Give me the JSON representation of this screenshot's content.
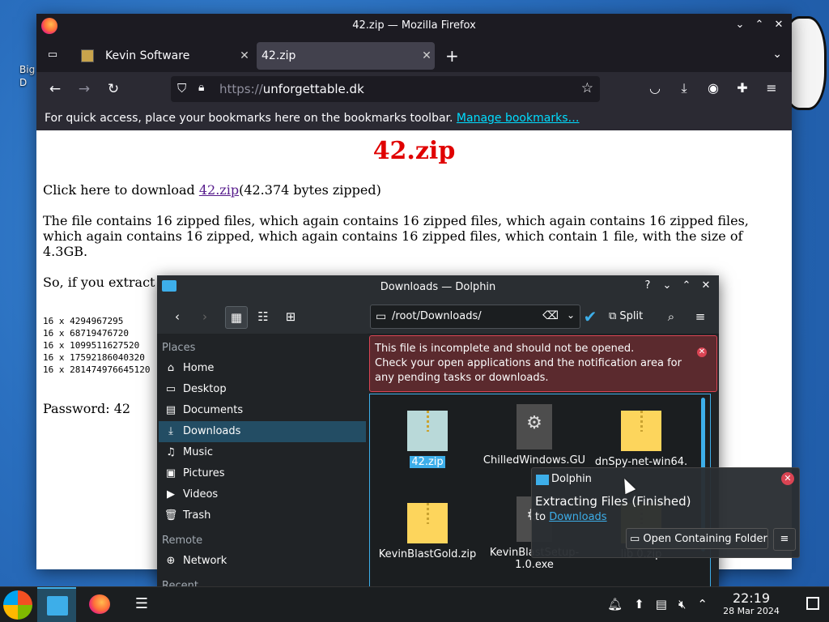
{
  "desktop": {
    "icon_label": "Big D"
  },
  "firefox": {
    "window_title": "42.zip — Mozilla Firefox",
    "tabs": [
      {
        "label": "Kevin Software"
      },
      {
        "label": "42.zip"
      }
    ],
    "url_host": "https://",
    "url_domain": "unforgettable.dk",
    "bookmarks_text": "For quick access, place your bookmarks here on the bookmarks toolbar.",
    "bookmarks_link": "Manage bookmarks…"
  },
  "page": {
    "heading": "42.zip",
    "download_prefix": "Click here to download ",
    "download_link": "42.zip",
    "download_suffix": "(42.374 bytes zipped)",
    "description": "The file contains 16 zipped files, which again contains 16 zipped files, which again contains 16 zipped files, which again contains 16 zipped, which again contains 16 zipped files, which contain 1 file, with the size of 4.3GB.",
    "so_text": "So, if you extract",
    "calc_lines": [
      "16 x 4294967295",
      "16 x 68719476720",
      "16 x 1099511627520",
      "16 x 17592186040320",
      "16 x 281474976645120"
    ],
    "password": "Password: 42"
  },
  "dolphin": {
    "title": "Downloads — Dolphin",
    "path": "/root/Downloads/",
    "split_label": "Split",
    "places_header": "Places",
    "places": [
      {
        "label": "Home",
        "icon": "home-icon"
      },
      {
        "label": "Desktop",
        "icon": "desktop-icon"
      },
      {
        "label": "Documents",
        "icon": "documents-icon"
      },
      {
        "label": "Downloads",
        "icon": "downloads-icon"
      },
      {
        "label": "Music",
        "icon": "music-icon"
      },
      {
        "label": "Pictures",
        "icon": "pictures-icon"
      },
      {
        "label": "Videos",
        "icon": "videos-icon"
      },
      {
        "label": "Trash",
        "icon": "trash-icon"
      }
    ],
    "remote_header": "Remote",
    "remote_items": [
      {
        "label": "Network"
      }
    ],
    "recent_header": "Recent",
    "warning_line1": "This file is incomplete and should not be opened.",
    "warning_line2": "Check your open applications and the notification area for any pending tasks or downloads.",
    "files": [
      {
        "name": "42.zip",
        "type": "zip"
      },
      {
        "name": "ChilledWindows.GU",
        "type": "exe"
      },
      {
        "name": "dnSpy-net-win64.",
        "type": "zip"
      },
      {
        "name": "KevinBlastGold.zip",
        "type": "zip"
      },
      {
        "name": "KevinBlastSetup-1.0.exe",
        "type": "exe"
      },
      {
        "name": "lib 0.zip",
        "type": "zip"
      }
    ]
  },
  "notification": {
    "app": "Dolphin",
    "heading": "Extracting Files (Finished)",
    "to_prefix": "to ",
    "to_link": "Downloads",
    "open_folder": "Open Containing Folder"
  },
  "taskbar": {
    "time": "22:19",
    "date": "28 Mar 2024"
  }
}
